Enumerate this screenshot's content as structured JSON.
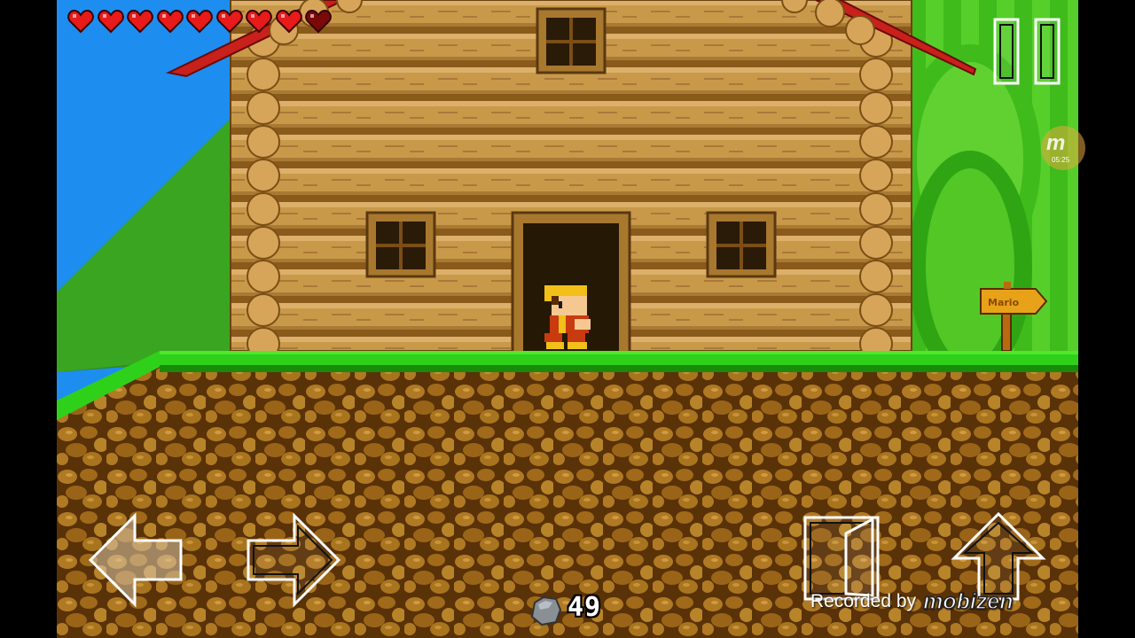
{
  "hud": {
    "hearts_total": 9,
    "hearts_filled": 8,
    "rock_count": "49",
    "rock_icon": "stone-icon",
    "pause_icon": "pause-icon"
  },
  "controls": {
    "left_icon": "arrow-left-icon",
    "right_icon": "arrow-right-icon",
    "action_icon": "throw-door-icon",
    "jump_icon": "arrow-up-icon"
  },
  "scene": {
    "signpost_text": "Mario"
  },
  "recorder": {
    "label": "Recorded by",
    "brand": "mobizen",
    "badge_letter": "m",
    "badge_time": "05:25"
  },
  "colors": {
    "sky": "#1d8df0",
    "grass": "#2fd01a",
    "dirt": "#7a4a10",
    "log": "#c89a4a",
    "heart_full": "#e81a1a",
    "heart_empty": "#7a0a0a"
  }
}
